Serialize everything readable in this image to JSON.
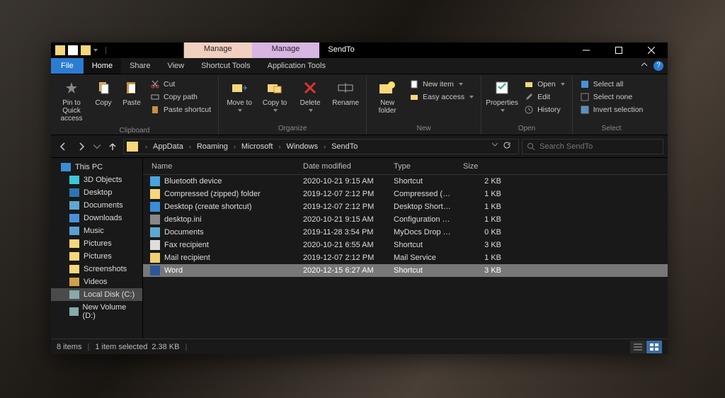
{
  "window": {
    "title": "SendTo"
  },
  "context_tabs": [
    {
      "label": "Manage",
      "group": "Shortcut Tools"
    },
    {
      "label": "Manage",
      "group": "Application Tools"
    }
  ],
  "menus": {
    "file": "File",
    "home": "Home",
    "share": "Share",
    "view": "View",
    "shortcut_tools": "Shortcut Tools",
    "application_tools": "Application Tools"
  },
  "ribbon": {
    "clipboard": {
      "label": "Clipboard",
      "pin": "Pin to Quick access",
      "copy": "Copy",
      "paste": "Paste",
      "cut": "Cut",
      "copy_path": "Copy path",
      "paste_shortcut": "Paste shortcut"
    },
    "organize": {
      "label": "Organize",
      "move_to": "Move to",
      "copy_to": "Copy to",
      "delete": "Delete",
      "rename": "Rename"
    },
    "new": {
      "label": "New",
      "new_folder": "New folder",
      "new_item": "New item",
      "easy_access": "Easy access"
    },
    "open": {
      "label": "Open",
      "properties": "Properties",
      "open": "Open",
      "edit": "Edit",
      "history": "History"
    },
    "select": {
      "label": "Select",
      "select_all": "Select all",
      "select_none": "Select none",
      "invert": "Invert selection"
    }
  },
  "breadcrumb": [
    "AppData",
    "Roaming",
    "Microsoft",
    "Windows",
    "SendTo"
  ],
  "search": {
    "placeholder": "Search SendTo"
  },
  "columns": {
    "name": "Name",
    "date": "Date modified",
    "type": "Type",
    "size": "Size"
  },
  "sidebar": [
    {
      "label": "This PC",
      "icon": "sb-pc",
      "indent": false
    },
    {
      "label": "3D Objects",
      "icon": "sb-3d",
      "indent": true
    },
    {
      "label": "Desktop",
      "icon": "sb-desktop",
      "indent": true
    },
    {
      "label": "Documents",
      "icon": "sb-docs",
      "indent": true
    },
    {
      "label": "Downloads",
      "icon": "sb-down",
      "indent": true
    },
    {
      "label": "Music",
      "icon": "sb-music",
      "indent": true
    },
    {
      "label": "Pictures",
      "icon": "sb-pic",
      "indent": true
    },
    {
      "label": "Pictures",
      "icon": "sb-pic",
      "indent": true
    },
    {
      "label": "Screenshots",
      "icon": "sb-pic",
      "indent": true
    },
    {
      "label": "Videos",
      "icon": "sb-vid",
      "indent": true
    },
    {
      "label": "Local Disk (C:)",
      "icon": "sb-disk",
      "indent": true,
      "selected": true
    },
    {
      "label": "New Volume (D:)",
      "icon": "sb-disk",
      "indent": true
    }
  ],
  "files": [
    {
      "name": "Bluetooth device",
      "date": "2020-10-21 9:15 AM",
      "type": "Shortcut",
      "size": "2 KB",
      "color": "#4aa3df"
    },
    {
      "name": "Compressed (zipped) folder",
      "date": "2019-12-07 2:12 PM",
      "type": "Compressed (zipp...",
      "size": "1 KB",
      "color": "#f6d77a"
    },
    {
      "name": "Desktop (create shortcut)",
      "date": "2019-12-07 2:12 PM",
      "type": "Desktop Shortcut",
      "size": "1 KB",
      "color": "#3a8dd8"
    },
    {
      "name": "desktop.ini",
      "date": "2020-10-21 9:15 AM",
      "type": "Configuration setti...",
      "size": "1 KB",
      "color": "#888"
    },
    {
      "name": "Documents",
      "date": "2019-11-28 3:54 PM",
      "type": "MyDocs Drop Targ...",
      "size": "0 KB",
      "color": "#5fa8d3"
    },
    {
      "name": "Fax recipient",
      "date": "2020-10-21 6:55 AM",
      "type": "Shortcut",
      "size": "3 KB",
      "color": "#ddd"
    },
    {
      "name": "Mail recipient",
      "date": "2019-12-07 2:12 PM",
      "type": "Mail Service",
      "size": "1 KB",
      "color": "#f0d070"
    },
    {
      "name": "Word",
      "date": "2020-12-15 6:27 AM",
      "type": "Shortcut",
      "size": "3 KB",
      "color": "#2b579a",
      "selected": true
    }
  ],
  "status": {
    "items": "8 items",
    "selected": "1 item selected",
    "size": "2.38 KB"
  }
}
